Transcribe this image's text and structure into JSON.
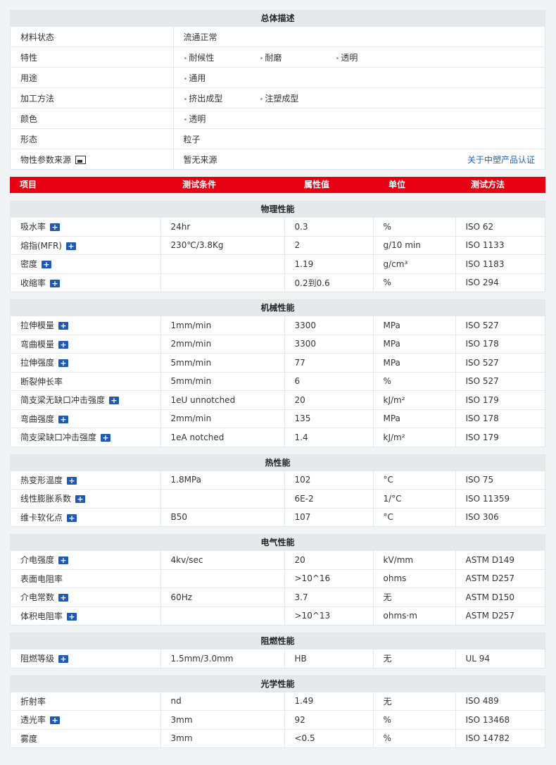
{
  "overview": {
    "title": "总体描述",
    "rows": [
      {
        "label": "材料状态",
        "value": "流通正常"
      },
      {
        "label": "特性",
        "items": [
          "耐候性",
          "耐磨",
          "透明"
        ]
      },
      {
        "label": "用途",
        "items": [
          "通用"
        ]
      },
      {
        "label": "加工方法",
        "items": [
          "挤出成型",
          "注塑成型"
        ]
      },
      {
        "label": "颜色",
        "items": [
          "透明"
        ]
      },
      {
        "label": "形态",
        "value": "粒子"
      },
      {
        "label": "物性参数来源",
        "value": "暂无来源",
        "link": "关于中塑产品认证"
      }
    ]
  },
  "header": {
    "columns": [
      "项目",
      "测试条件",
      "属性值",
      "单位",
      "测试方法"
    ]
  },
  "sections": [
    {
      "title": "物理性能",
      "rows": [
        {
          "name": "吸水率",
          "info": true,
          "cond": "24hr",
          "value": "0.3",
          "unit": "%",
          "method": "ISO 62"
        },
        {
          "name": "熔指(MFR)",
          "info": true,
          "cond": "230℃/3.8Kg",
          "value": "2",
          "unit": "g/10 min",
          "method": "ISO 1133"
        },
        {
          "name": "密度",
          "info": true,
          "cond": "",
          "value": "1.19",
          "unit": "g/cm³",
          "method": "ISO 1183"
        },
        {
          "name": "收缩率",
          "info": true,
          "cond": "",
          "value": "0.2到0.6",
          "unit": "%",
          "method": "ISO 294"
        }
      ]
    },
    {
      "title": "机械性能",
      "rows": [
        {
          "name": "拉伸模量",
          "info": true,
          "cond": "1mm/min",
          "value": "3300",
          "unit": "MPa",
          "method": "ISO 527"
        },
        {
          "name": "弯曲模量",
          "info": true,
          "cond": "2mm/min",
          "value": "3300",
          "unit": "MPa",
          "method": "ISO 178"
        },
        {
          "name": "拉伸强度",
          "info": true,
          "cond": "5mm/min",
          "value": "77",
          "unit": "MPa",
          "method": "ISO 527"
        },
        {
          "name": "断裂伸长率",
          "info": false,
          "cond": "5mm/min",
          "value": "6",
          "unit": "%",
          "method": "ISO 527"
        },
        {
          "name": "简支梁无缺口冲击强度",
          "info": true,
          "cond": "1eU unnotched",
          "value": "20",
          "unit": "kJ/m²",
          "method": "ISO 179"
        },
        {
          "name": "弯曲强度",
          "info": true,
          "cond": "2mm/min",
          "value": "135",
          "unit": "MPa",
          "method": "ISO 178"
        },
        {
          "name": "简支梁缺口冲击强度",
          "info": true,
          "cond": "1eA notched",
          "value": "1.4",
          "unit": "kJ/m²",
          "method": "ISO 179"
        }
      ]
    },
    {
      "title": "热性能",
      "rows": [
        {
          "name": "热变形温度",
          "info": true,
          "cond": "1.8MPa",
          "value": "102",
          "unit": "°C",
          "method": "ISO 75"
        },
        {
          "name": "线性膨胀系数",
          "info": true,
          "cond": "",
          "value": "6E-2",
          "unit": "1/°C",
          "method": "ISO 11359"
        },
        {
          "name": "维卡软化点",
          "info": true,
          "cond": "B50",
          "value": "107",
          "unit": "°C",
          "method": "ISO 306"
        }
      ]
    },
    {
      "title": "电气性能",
      "rows": [
        {
          "name": "介电强度",
          "info": true,
          "cond": "4kv/sec",
          "value": "20",
          "unit": "kV/mm",
          "method": "ASTM D149"
        },
        {
          "name": "表面电阻率",
          "info": false,
          "cond": "",
          "value": ">10^16",
          "unit": "ohms",
          "method": "ASTM D257"
        },
        {
          "name": "介电常数",
          "info": true,
          "cond": "60Hz",
          "value": "3.7",
          "unit": "无",
          "method": "ASTM D150"
        },
        {
          "name": "体积电阻率",
          "info": true,
          "cond": "",
          "value": ">10^13",
          "unit": "ohms·m",
          "method": "ASTM D257"
        }
      ]
    },
    {
      "title": "阻燃性能",
      "rows": [
        {
          "name": "阻燃等级",
          "info": true,
          "cond": "1.5mm/3.0mm",
          "value": "HB",
          "unit": "无",
          "method": "UL 94"
        }
      ]
    },
    {
      "title": "光学性能",
      "rows": [
        {
          "name": "折射率",
          "info": false,
          "cond": "nd",
          "value": "1.49",
          "unit": "无",
          "method": "ISO 489"
        },
        {
          "name": "透光率",
          "info": true,
          "cond": "3mm",
          "value": "92",
          "unit": "%",
          "method": "ISO 13468"
        },
        {
          "name": "雾度",
          "info": false,
          "cond": "3mm",
          "value": "<0.5",
          "unit": "%",
          "method": "ISO 14782"
        }
      ]
    }
  ]
}
